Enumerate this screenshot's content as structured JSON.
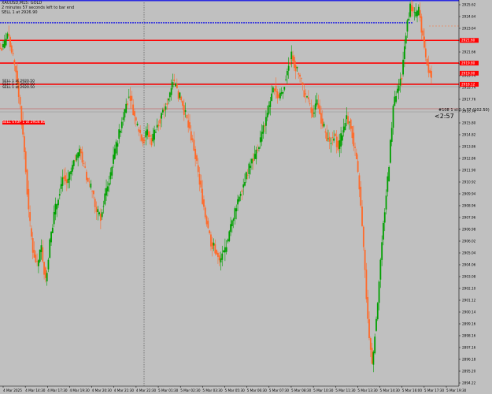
{
  "window": {
    "symbol_line": "XAUUSD,M15: GOLD",
    "timer_line": "2 minutes 57 seconds left to bar end",
    "order_line": "SELL 1 at 2926.90",
    "countdown": "<2:57",
    "bid_tag": "#108 1 sl:0.1.77 (102.50)",
    "sell_stop_label": "SELL STOP 1 at 2918.80",
    "left_tags": [
      "SELL 1 at 2920.50",
      "SELL 1 at 2920.50",
      "SELL 1 at 2920.50"
    ]
  },
  "chart_data": {
    "type": "candlestick",
    "title": "",
    "xlabel": "",
    "ylabel": "",
    "ylim": [
      2894.2,
      2924.8
    ],
    "y_ticks": [
      "2925.62",
      "2924.64",
      "2923.64",
      "2922.68",
      "2921.66",
      "2920.72",
      "2919.74",
      "2918.74",
      "2917.76",
      "2916.78",
      "2915.80",
      "2914.82",
      "2913.86",
      "2912.86",
      "2911.90",
      "2910.92",
      "2909.94",
      "2908.96",
      "2907.96",
      "2906.98",
      "2906.02",
      "2905.04",
      "2904.06",
      "2903.08",
      "2902.10",
      "2901.12",
      "2900.14",
      "2899.16",
      "2898.16",
      "2897.16",
      "2896.18",
      "2895.20",
      "2894.22"
    ],
    "x_ticks": [
      "4 Mar 2025",
      "4 Mar 14:30",
      "4 Mar 17:30",
      "4 Mar 19:30",
      "4 Mar 20:30",
      "4 Mar 21:30",
      "4 Mar 22:30",
      "5 Mar 01:30",
      "5 Mar 02:30",
      "5 Mar 03:30",
      "5 Mar 05:30",
      "5 Mar 06:30",
      "5 Mar 07:30",
      "5 Mar 08:30",
      "5 Mar 10:30",
      "5 Mar 11:30",
      "5 Mar 13:30",
      "5 Mar 14:30",
      "5 Mar 16:00",
      "5 Mar 17:30",
      "5 Mar 19:30"
    ],
    "bull_color": "#00a000",
    "bear_color": "#ff6a2a",
    "line_color": "#ff0000",
    "top_line_color": "#2a2ae0",
    "horizontal_levels": [
      {
        "price": 2924.75,
        "color": "#2a2ae0"
      },
      {
        "price": 2923.0,
        "color": "#2a2ae0"
      },
      {
        "price": 2921.6,
        "color": "#ff0000"
      },
      {
        "price": 2919.8,
        "color": "#ff0000"
      },
      {
        "price": 2918.12,
        "color": "#ff0000"
      }
    ],
    "price_labels": [
      {
        "price": 2921.6,
        "text": "2921.60",
        "bg": "#ff0000"
      },
      {
        "price": 2919.8,
        "text": "2919.80",
        "bg": "#ff0000"
      },
      {
        "price": 2918.12,
        "text": "2918.12",
        "bg": "#ff0000"
      },
      {
        "price": 2919.0,
        "text": "2919.00",
        "bg": "#ff0000"
      }
    ],
    "series_close": [
      2921.0,
      2922.1,
      2920.6,
      2919.2,
      2916.4,
      2912.8,
      2908.0,
      2905.0,
      2903.7,
      2905.2,
      2902.5,
      2905.6,
      2907.8,
      2909.3,
      2910.8,
      2910.3,
      2911.2,
      2912.1,
      2913.0,
      2911.6,
      2910.4,
      2909.7,
      2908.0,
      2907.6,
      2909.3,
      2910.6,
      2912.2,
      2913.8,
      2915.3,
      2916.6,
      2917.2,
      2915.5,
      2914.5,
      2913.7,
      2914.4,
      2913.6,
      2914.7,
      2915.4,
      2916.1,
      2917.1,
      2918.5,
      2917.6,
      2916.8,
      2915.7,
      2914.4,
      2913.0,
      2911.0,
      2909.0,
      2907.3,
      2905.6,
      2905.0,
      2904.0,
      2904.8,
      2905.7,
      2907.3,
      2908.6,
      2909.7,
      2910.6,
      2911.5,
      2912.2,
      2913.0,
      2914.2,
      2915.5,
      2916.8,
      2918.0,
      2917.0,
      2917.7,
      2919.2,
      2920.4,
      2919.4,
      2918.6,
      2917.4,
      2916.6,
      2915.8,
      2916.6,
      2915.4,
      2914.3,
      2913.4,
      2914.2,
      2913.0,
      2914.3,
      2915.6,
      2914.8,
      2912.7,
      2910.0,
      2905.0,
      2899.5,
      2895.9,
      2899.5,
      2904.2,
      2908.2,
      2911.9,
      2916.4,
      2917.6,
      2918.9,
      2922.3,
      2924.4,
      2923.5,
      2924.0,
      2921.9,
      2919.7,
      2918.8
    ]
  }
}
